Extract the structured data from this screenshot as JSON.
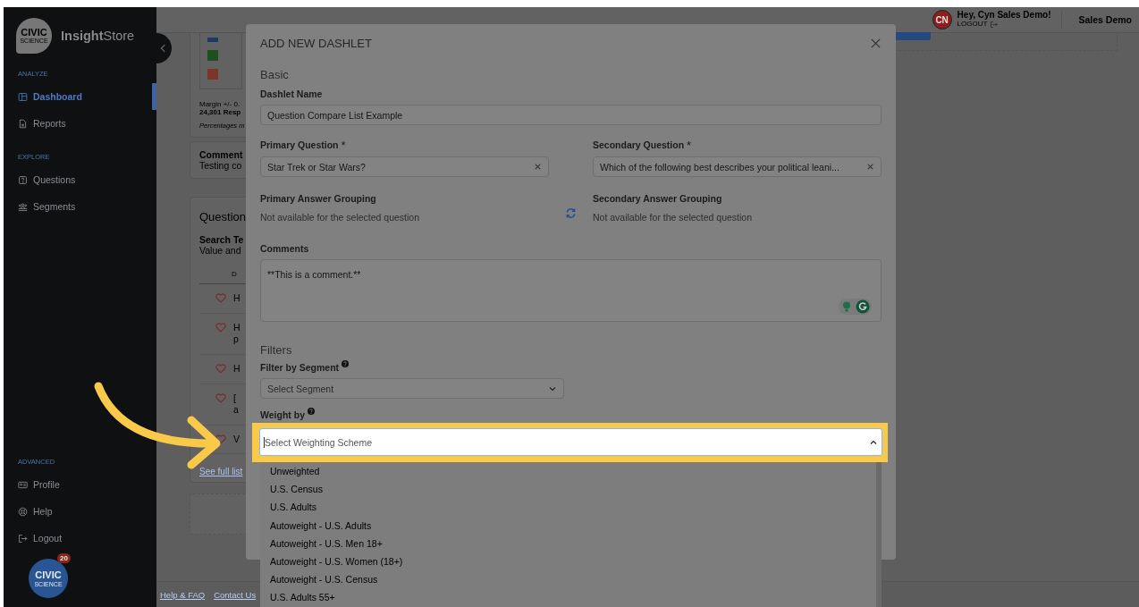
{
  "sidebar": {
    "logo": [
      "CIVIC",
      "SCIENCE"
    ],
    "brand": "**Insight**Store",
    "sections": [
      {
        "label": "ANALYZE",
        "items": [
          {
            "label": "Dashboard",
            "kind": "dashboard",
            "selected": true
          },
          {
            "label": "Reports",
            "kind": "reports",
            "selected": false
          }
        ]
      },
      {
        "label": "EXPLORE",
        "items": [
          {
            "label": "Questions",
            "kind": "questions",
            "selected": false
          },
          {
            "label": "Segments",
            "kind": "segments",
            "selected": false
          }
        ]
      },
      {
        "label": "ADVANCED",
        "items": [
          {
            "label": "Profile",
            "kind": "profile",
            "selected": false
          },
          {
            "label": "Help",
            "kind": "help",
            "selected": false
          },
          {
            "label": "Logout",
            "kind": "logout",
            "selected": false
          }
        ]
      }
    ],
    "chat": {
      "logo": [
        "CIVIC",
        "SCIENCE"
      ],
      "badge": "20"
    }
  },
  "header": {
    "avatar": "CN",
    "greeting": "Hey, Cyn Sales Demo!",
    "logout": "LOGOUT",
    "account": "Sales Demo"
  },
  "background": {
    "legend": [
      {
        "color": "#1d3a66"
      },
      {
        "color": "#1f4f1f"
      },
      {
        "color": "#7a3626"
      }
    ],
    "margin": "Margin +/- 0.",
    "respondents": "24,301 Resp",
    "note": "Percentages m",
    "comment": {
      "title": "Comment",
      "text": "Testing co"
    },
    "questions": {
      "title": "Question",
      "search_label": "Search Te",
      "search_text": "Value and",
      "column": "D",
      "rows": [
        {
          "lines": [
            "H"
          ]
        },
        {
          "lines": [
            "H",
            "p"
          ]
        },
        {
          "lines": [
            "H"
          ]
        },
        {
          "lines": [
            "[",
            "a"
          ]
        },
        {
          "lines": [
            "V"
          ]
        }
      ],
      "link": "See full list"
    },
    "footer": [
      "Help & FAQ",
      "Contact Us"
    ]
  },
  "modal": {
    "title": "ADD NEW DASHLET",
    "basic_heading": "Basic",
    "dashlet_name": {
      "label": "Dashlet Name",
      "value": "Question Compare List Example"
    },
    "primary_question": {
      "label": "Primary Question",
      "required_mark": "*",
      "value": "Star Trek or Star Wars?"
    },
    "secondary_question": {
      "label": "Secondary Question",
      "required_mark": "*",
      "value": "Which of the following best describes your political leani..."
    },
    "primary_grouping": {
      "label": "Primary Answer Grouping",
      "note": "Not available for the selected question"
    },
    "secondary_grouping": {
      "label": "Secondary Answer Grouping",
      "note": "Not available for the selected question"
    },
    "comments": {
      "label": "Comments",
      "value": "**This is a comment.**"
    },
    "filters_heading": "Filters",
    "segment_filter": {
      "label": "Filter by Segment",
      "placeholder": "Select Segment"
    },
    "weight": {
      "label": "Weight by",
      "placeholder": "Select Weighting Scheme",
      "highlighted": true,
      "expanded": true,
      "options": [
        "Unweighted",
        "U.S. Census",
        "U.S. Adults",
        "Autoweight - U.S. Adults",
        "Autoweight - U.S. Men 18+",
        "Autoweight - U.S. Women (18+)",
        "Autoweight - U.S. Census",
        "U.S. Adults 55+"
      ]
    }
  }
}
